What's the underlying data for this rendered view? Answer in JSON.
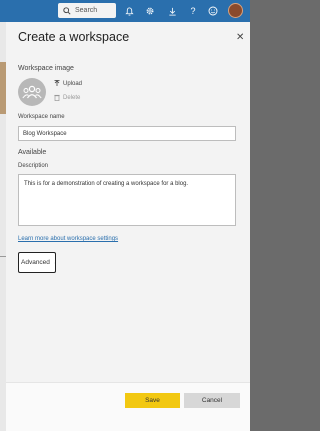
{
  "topbar": {
    "search_placeholder": "Search",
    "icons": [
      "search-icon",
      "bell-icon",
      "gear-icon",
      "download-icon",
      "help-icon",
      "smiley-icon",
      "avatar"
    ]
  },
  "panel": {
    "title": "Create a workspace",
    "close_glyph": "✕",
    "image_section": {
      "label": "Workspace image",
      "upload_label": "Upload",
      "delete_label": "Delete"
    },
    "name_field": {
      "label": "Workspace name",
      "value": "Blog Workspace",
      "availability": "Available"
    },
    "description_field": {
      "label": "Description",
      "value": "This is for a demonstration of creating a workspace for a blog."
    },
    "learn_more_link": "Learn more about workspace settings",
    "advanced_label": "Advanced",
    "footer": {
      "save_label": "Save",
      "cancel_label": "Cancel"
    }
  },
  "colors": {
    "topbar": "#2a6fad",
    "save_button": "#f2c811",
    "cancel_button": "#d7d7d7",
    "link": "#2a6fad"
  }
}
